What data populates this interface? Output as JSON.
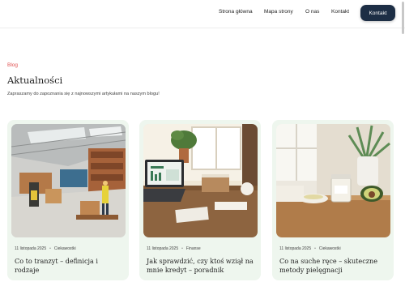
{
  "nav": {
    "items": [
      "Strona główna",
      "Mapa strony",
      "O nas",
      "Kontakt"
    ],
    "cta": "Kontakt",
    "cta_color": "#1d2e45"
  },
  "hero": {
    "eyebrow": "Blog",
    "title": "Aktualności",
    "subtitle": "Zapraszamy do zapoznania się z najnowszymi artykułami na naszym blogu!"
  },
  "posts": [
    {
      "date": "11 listopada 2025",
      "category": "Ciekawostki",
      "title": "Co to tranzyt – definicja i rodzaje",
      "image": "warehouse-photo"
    },
    {
      "date": "11 listopada 2025",
      "category": "Finanse",
      "title": "Jak sprawdzić, czy ktoś wziął na mnie kredyt – poradnik",
      "image": "desk-laptop-photo"
    },
    {
      "date": "11 listopada 2025",
      "category": "Ciekawostki",
      "title": "Co na suche ręce – skuteczne metody pielęgnacji",
      "image": "skincare-jar-photo"
    }
  ],
  "colors": {
    "accent": "#e05252",
    "card_bg": "#eef6ee"
  }
}
